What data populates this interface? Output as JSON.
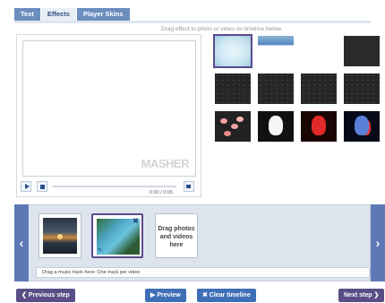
{
  "tabs": [
    {
      "label": "Text",
      "active": false
    },
    {
      "label": "Effects",
      "active": true
    },
    {
      "label": "Player Skins",
      "active": false
    }
  ],
  "hint": "Drag effect to photo or video on timeline below.",
  "player": {
    "watermark": "MASHER",
    "timecode": "0:00 / 0:05"
  },
  "effects": [
    {
      "icon": "blur-effect",
      "selected": true
    },
    {
      "icon": "drip-effect",
      "selected": false
    },
    {
      "icon": "blank-effect",
      "selected": false
    },
    {
      "icon": "dark-effect",
      "selected": false
    },
    {
      "icon": "noise-effect",
      "selected": false
    },
    {
      "icon": "noise-effect",
      "selected": false
    },
    {
      "icon": "noise-effect",
      "selected": false
    },
    {
      "icon": "noise-effect",
      "selected": false
    },
    {
      "icon": "flowers-effect",
      "selected": false
    },
    {
      "icon": "bw-face-effect",
      "selected": false
    },
    {
      "icon": "red-face-effect",
      "selected": false
    },
    {
      "icon": "blue-face-effect",
      "selected": false
    }
  ],
  "timeline": {
    "drop_text": "Drag photos and videos here",
    "music_hint": "Drag a music track here: One track per video"
  },
  "buttons": {
    "prev": "❮ Previous step",
    "preview": "▶ Preview",
    "clear": "✖ Clear timeline",
    "next": "Next step ❯"
  },
  "colors": {
    "accent_purple": "#5a4e86",
    "accent_blue": "#3f6fb7",
    "tab_blue": "#6b8ebf"
  }
}
